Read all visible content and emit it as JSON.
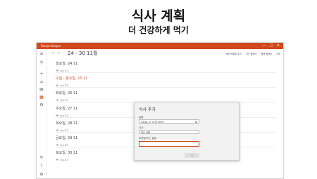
{
  "hero": {
    "title": "식사 계획",
    "subtitle": "더 건강하게 먹기"
  },
  "window": {
    "title": "Recipe Keeper",
    "controls": [
      "—",
      "□",
      "✕"
    ]
  },
  "sidebar": {
    "icons": [
      "menu-icon",
      "search-icon",
      "add-icon",
      "home-icon",
      "book-icon",
      "calendar-icon",
      "settings-icon",
      "sync-icon",
      "help-icon",
      "gear-icon"
    ]
  },
  "toolbar": {
    "week_range": "24 - 30 11월",
    "actions": [
      "쇼핑 목록에 추가",
      "지난 플래너",
      "플랜 플래너",
      "인쇄"
    ]
  },
  "days": [
    {
      "name": "일요일, 24 11",
      "add": "식사 추가",
      "today": false
    },
    {
      "name": "오늘 - 월요일, 25 11",
      "add": "식사 추가",
      "today": true
    },
    {
      "name": "화요일, 26 11",
      "add": "식사 추가",
      "today": false
    },
    {
      "name": "수요일, 27 11",
      "add": "식사 추가",
      "today": false
    },
    {
      "name": "목요일, 28 11",
      "add": "식사 추가",
      "today": false
    },
    {
      "name": "금요일, 29 11",
      "add": "식사 추가",
      "today": false
    },
    {
      "name": "토요일, 30 11",
      "add": "식사 추가",
      "today": false
    }
  ],
  "dialog": {
    "title": "식사 추가",
    "date_label": "날짜",
    "date_value": "수요일, 27 11월 2019",
    "meal_label": "식사",
    "meal_value": "끼니 선택",
    "recipe_label": "조리법 또는 설명",
    "recipe_value": "",
    "save_label": "저장"
  }
}
